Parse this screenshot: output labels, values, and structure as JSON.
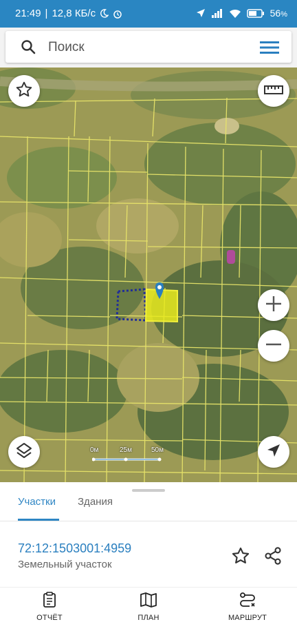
{
  "status_bar": {
    "time": "21:49",
    "network_speed": "12,8 КБ/с",
    "battery": "56",
    "battery_unit": "%"
  },
  "search": {
    "placeholder": "Поиск"
  },
  "map": {
    "scale": {
      "labels": [
        "0м",
        "25м",
        "50м"
      ]
    },
    "selected_color": "#e8ea1f",
    "parcel_line_color": "#e8e46a"
  },
  "sheet": {
    "tabs": [
      {
        "label": "Участки",
        "active": true
      },
      {
        "label": "Здания",
        "active": false
      }
    ],
    "parcel": {
      "number": "72:12:1503001:4959",
      "type": "Земельный участок"
    }
  },
  "bottom_nav": {
    "items": [
      {
        "label": "ОТЧЁТ",
        "icon": "report-icon"
      },
      {
        "label": "ПЛАН",
        "icon": "map-icon"
      },
      {
        "label": "МАРШРУТ",
        "icon": "route-icon"
      }
    ]
  },
  "colors": {
    "accent": "#2f86c4",
    "status_bar": "#2a86c2"
  }
}
